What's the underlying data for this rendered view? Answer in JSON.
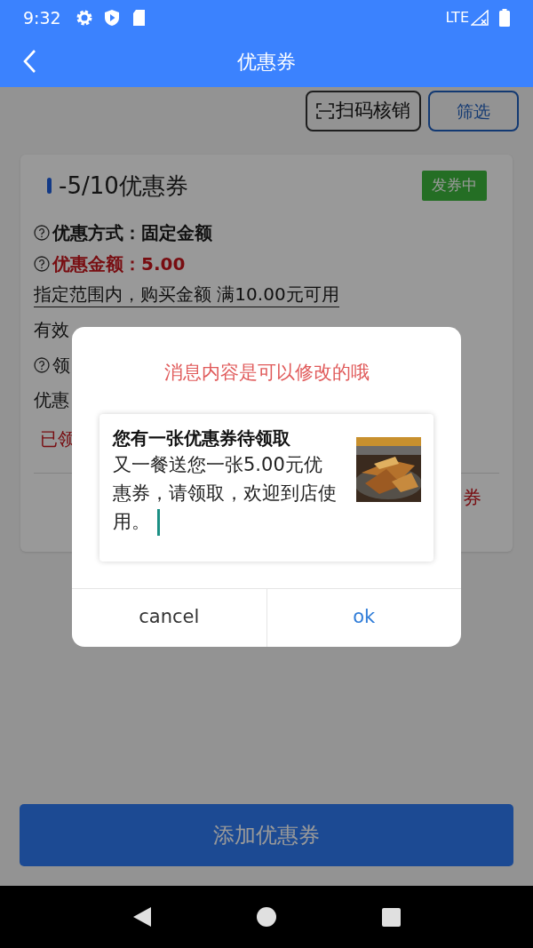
{
  "status_bar": {
    "time": "9:32",
    "network": "LTE"
  },
  "app_bar": {
    "title": "优惠券"
  },
  "toolbar": {
    "scan_button": "扫码核销",
    "filter_button": "筛选"
  },
  "coupon": {
    "title": "-5/10优惠券",
    "status": "发券中",
    "lines": [
      {
        "kind": "help",
        "bold": true,
        "red": false,
        "text": "优惠方式：固定金额"
      },
      {
        "kind": "help",
        "bold": true,
        "red": true,
        "text": "优惠金额：5.00"
      },
      {
        "kind": "underlined",
        "bold": false,
        "red": false,
        "text": "指定范围内，购买金额 满10.00元可用"
      },
      {
        "kind": "plain",
        "bold": false,
        "red": false,
        "text": "有效"
      },
      {
        "kind": "help",
        "bold": false,
        "red": false,
        "text": "领"
      },
      {
        "kind": "plain",
        "bold": false,
        "red": false,
        "text": "优惠"
      },
      {
        "kind": "plain",
        "bold": false,
        "red": true,
        "text": "已领"
      }
    ],
    "action": "券"
  },
  "dialog": {
    "title": "消息内容是可以修改的哦",
    "message": {
      "title": "您有一张优惠券待领取",
      "body": "又一餐送您一张5.00元优惠券，请领取，欢迎到店使用。",
      "focused": true,
      "kind": "picture"
    },
    "buttons": [
      {
        "label": "cancel",
        "kind": "neutral"
      },
      {
        "label": "ok",
        "kind": "primary"
      }
    ]
  },
  "add_button": "添加优惠券"
}
